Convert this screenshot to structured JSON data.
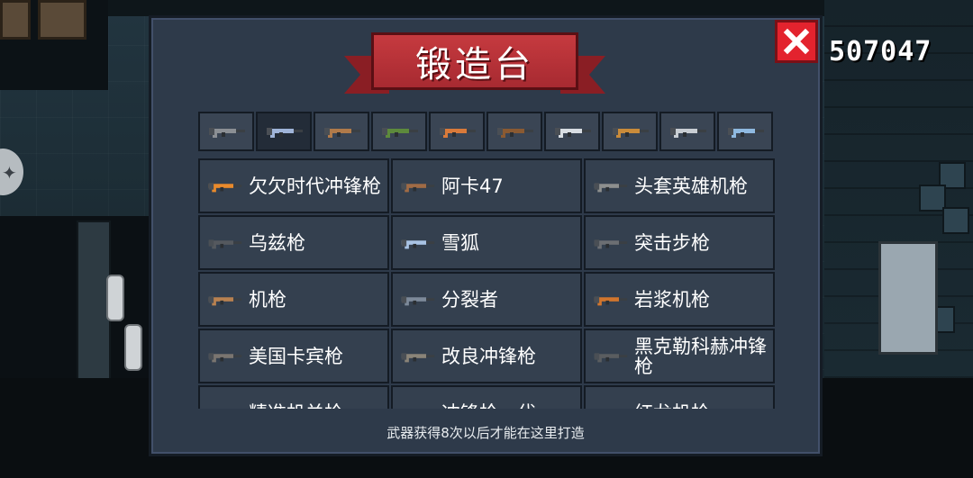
{
  "title": "锻造台",
  "coins": "507047",
  "close_icon": "close-x-icon",
  "category_tabs": [
    {
      "name": "pistol-icon",
      "color": "#8b8f94"
    },
    {
      "name": "rifle-icon",
      "color": "#9fb4d8"
    },
    {
      "name": "shotgun-icon",
      "color": "#b07a4a"
    },
    {
      "name": "launcher-icon",
      "color": "#5d8a3c"
    },
    {
      "name": "blaster-icon",
      "color": "#d97a3a"
    },
    {
      "name": "bow-icon",
      "color": "#8a5a32"
    },
    {
      "name": "sword-icon",
      "color": "#d8dde2"
    },
    {
      "name": "staff-icon",
      "color": "#c98b3a"
    },
    {
      "name": "throwing-star-icon",
      "color": "#c9ced3"
    },
    {
      "name": "fish-icon",
      "color": "#8fb9e0"
    }
  ],
  "weapons": [
    {
      "label": "欠欠时代冲锋枪",
      "icon": "smg-icon",
      "color": "#e98a2c"
    },
    {
      "label": "阿卡47",
      "icon": "ak47-icon",
      "color": "#a06b45"
    },
    {
      "label": "头套英雄机枪",
      "icon": "machine-gun-icon",
      "color": "#8d8f8e"
    },
    {
      "label": "乌兹枪",
      "icon": "uzi-icon",
      "color": "#55595e"
    },
    {
      "label": "雪狐",
      "icon": "snow-fox-rifle-icon",
      "color": "#a9c3e4"
    },
    {
      "label": "突击步枪",
      "icon": "assault-rifle-icon",
      "color": "#6c6f73"
    },
    {
      "label": "机枪",
      "icon": "machine-gun-icon",
      "color": "#b98250"
    },
    {
      "label": "分裂者",
      "icon": "splitter-rifle-icon",
      "color": "#7d8a9a"
    },
    {
      "label": "岩浆机枪",
      "icon": "magma-gun-icon",
      "color": "#d2762d"
    },
    {
      "label": "美国卡宾枪",
      "icon": "carbine-icon",
      "color": "#7a7570"
    },
    {
      "label": "改良冲锋枪",
      "icon": "smg-icon",
      "color": "#8a8478"
    },
    {
      "label": "黑克勒科赫冲锋枪",
      "icon": "hk-smg-icon",
      "color": "#5a5d60"
    },
    {
      "label": "精准机关枪",
      "icon": "rifle-icon",
      "color": "#a07050"
    },
    {
      "label": "冲锋枪一代",
      "icon": "smg-icon",
      "color": "#c9a25a"
    },
    {
      "label": "红龙机枪",
      "icon": "dragon-gun-icon",
      "color": "#b9443b"
    }
  ],
  "footer_note": "武器获得8次以后才能在这里打造"
}
